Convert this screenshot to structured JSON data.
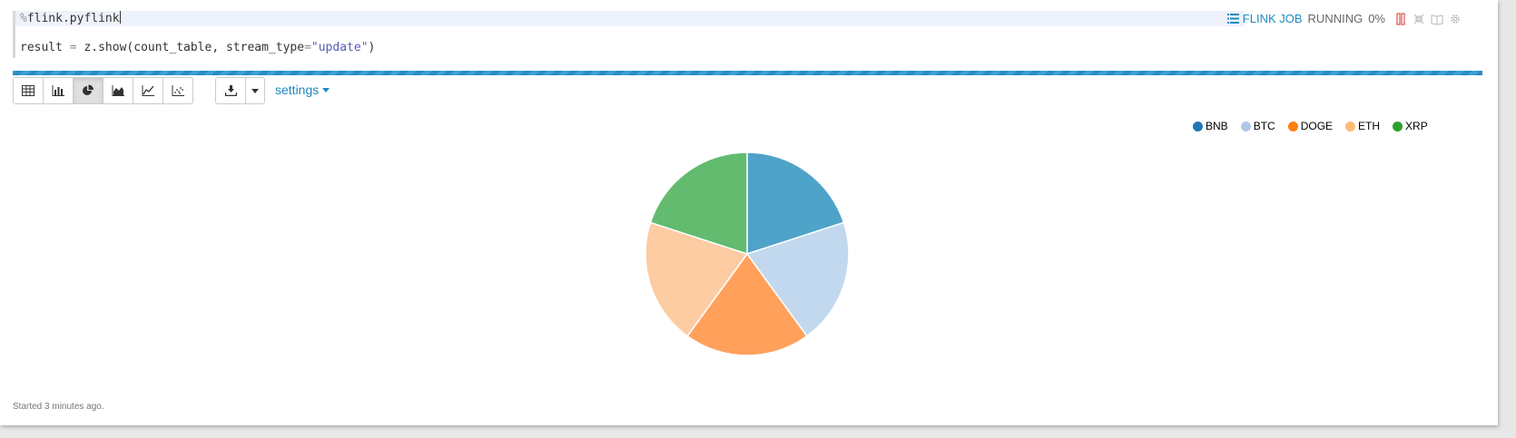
{
  "editor": {
    "line1_percent": "%",
    "line1_text": "flink.pyflink",
    "line2_prefix": "result ",
    "line2_eq": "=",
    "line2_mid": " z.show(count_table, stream_type",
    "line2_eq2": "=",
    "line2_str": "\"update\"",
    "line2_end": ")"
  },
  "controls": {
    "job_label": "FLINK JOB",
    "status": "RUNNING",
    "progress_text": "0%",
    "progress_fraction": 0.0
  },
  "toolbar": {
    "buttons": [
      "table-icon",
      "bar-chart-icon",
      "pie-chart-icon",
      "area-chart-icon",
      "line-chart-icon",
      "scatter-chart-icon"
    ],
    "active_index": 2,
    "download_icon": "download-icon",
    "dropdown_icon": "caret-down-icon",
    "settings_label": "settings"
  },
  "colors": {
    "accent": "#1f8ac0",
    "pause_red": "#d9534f"
  },
  "chart_data": {
    "type": "pie",
    "categories": [
      "BNB",
      "BTC",
      "DOGE",
      "ETH",
      "XRP"
    ],
    "values": [
      1,
      1,
      1,
      1,
      1
    ],
    "legend_position": "top-right",
    "legend_colors": [
      "#1f77b4",
      "#aec7e8",
      "#ff7f0e",
      "#ffbb78",
      "#2ca02c"
    ],
    "slice_colors": [
      "#4ea3c9",
      "#c1d8ee",
      "#ffa05b",
      "#fecca2",
      "#62bb6f"
    ]
  },
  "footer": {
    "text": "Started 3 minutes ago."
  }
}
